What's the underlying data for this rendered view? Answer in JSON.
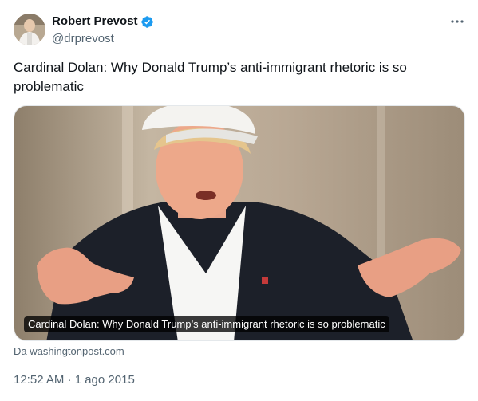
{
  "author": {
    "display_name": "Robert Prevost",
    "handle": "@drprevost",
    "verified": true,
    "verified_color": "#1d9bf0"
  },
  "tweet": {
    "text": "Cardinal Dolan: Why Donald Trump’s anti-immigrant rhetoric is so problematic",
    "timestamp": "12:52 AM · 1 ago 2015"
  },
  "card": {
    "caption": "Cardinal Dolan: Why Donald Trump’s anti-immigrant rhetoric is so problematic",
    "source": "Da washingtonpost.com"
  },
  "icons": {
    "more": "more-options-icon",
    "verified": "verified-badge-icon"
  }
}
